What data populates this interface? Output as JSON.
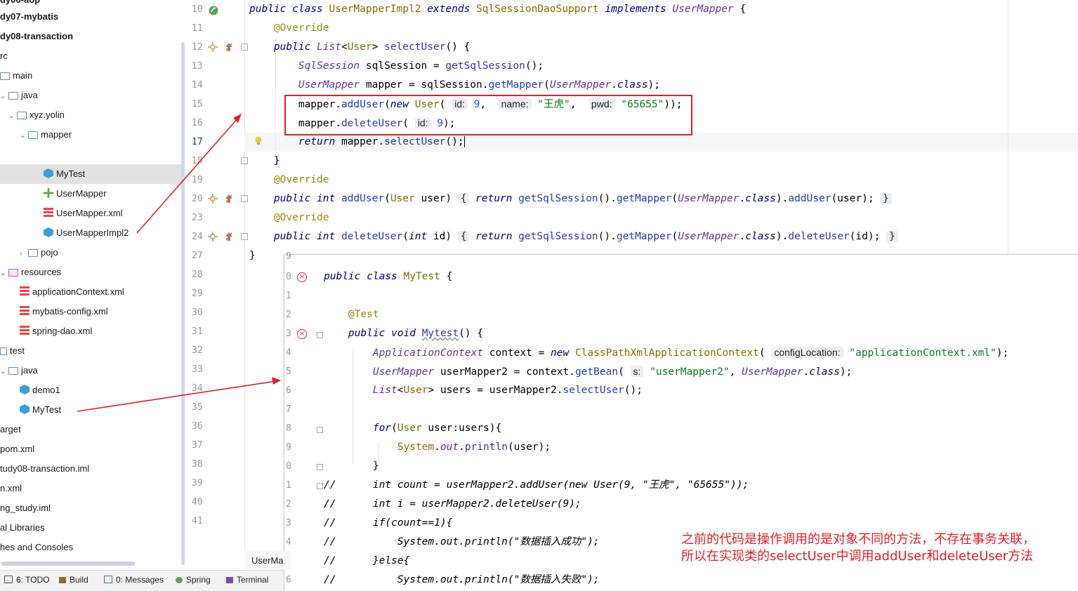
{
  "colors": {
    "accent_red": "#e0202a",
    "selection": "#e1e1e1"
  },
  "project_tree": [
    {
      "label": "dy06-aop",
      "bold": true,
      "icon": "module-folder-icon"
    },
    {
      "label": "dy07-mybatis",
      "bold": true,
      "icon": "module-folder-icon"
    },
    {
      "label": "dy08-transaction",
      "bold": true,
      "icon": "module-folder-icon"
    },
    {
      "label": "rc",
      "icon": "folder-icon"
    },
    {
      "label": "main",
      "icon": "folder-icon"
    },
    {
      "label": "java",
      "icon": "folder-icon"
    },
    {
      "label": "xyz.yolin",
      "icon": "package-icon"
    },
    {
      "label": "mapper",
      "icon": "package-icon"
    },
    {
      "label": "MyTest",
      "icon": "class-icon",
      "selected": true
    },
    {
      "label": "UserMapper",
      "icon": "interface-icon"
    },
    {
      "label": "UserMapper.xml",
      "icon": "xml-file-icon"
    },
    {
      "label": "UserMapperImpl2",
      "icon": "class-icon"
    },
    {
      "label": "pojo",
      "icon": "package-icon"
    },
    {
      "label": "resources",
      "icon": "resources-folder-icon"
    },
    {
      "label": "applicationContext.xml",
      "icon": "xml-file-icon"
    },
    {
      "label": "mybatis-config.xml",
      "icon": "xml-file-icon"
    },
    {
      "label": "spring-dao.xml",
      "icon": "xml-file-icon"
    },
    {
      "label": "test",
      "icon": "folder-icon"
    },
    {
      "label": "java",
      "icon": "folder-icon"
    },
    {
      "label": "demo1",
      "icon": "class-icon"
    },
    {
      "label": "MyTest",
      "icon": "class-icon"
    },
    {
      "label": "arget",
      "icon": "folder-icon"
    },
    {
      "label": "pom.xml",
      "icon": "xml-file-icon"
    },
    {
      "label": "tudy08-transaction.iml",
      "icon": "file-icon"
    },
    {
      "label": "n.xml",
      "icon": "xml-file-icon"
    },
    {
      "label": "ng_study.iml",
      "icon": "file-icon"
    },
    {
      "label": "al Libraries",
      "icon": "library-icon"
    },
    {
      "label": "hes and Consoles",
      "icon": "scratch-icon"
    }
  ],
  "editor": {
    "line_numbers": [
      "10",
      "11",
      "12",
      "13",
      "14",
      "15",
      "16",
      "17",
      "18",
      "19",
      "20",
      "23",
      "24",
      "27",
      "28",
      "29",
      "30",
      "31",
      "32",
      "33",
      "34",
      "35",
      "36",
      "37",
      "38",
      "39",
      "40",
      "41"
    ],
    "current_line": "17",
    "partial_tab": "UserMa",
    "hints": {
      "id": "id:",
      "name": "name:",
      "pwd": "pwd:"
    },
    "strings": {
      "wanghu": "\"王虎\"",
      "pwd_value": "\"65655\""
    },
    "numbers": {
      "nine": "9"
    }
  },
  "overlay": {
    "line_numbers": [
      "9",
      "0",
      "1",
      "2",
      "3",
      "4",
      "5",
      "6",
      "7",
      "8",
      "9",
      "0",
      "1",
      "2",
      "3",
      "4",
      "5",
      "6"
    ],
    "hints": {
      "configLocation": "configLocation:",
      "s": "s:"
    },
    "strings": {
      "app_ctx": "\"applicationContext.xml\"",
      "bean": "\"userMapper2\"",
      "comment_add": "//      int count = userMapper2.addUser(new User(9, \"王虎\", \"65655\"));",
      "comment_del": "//      int i = userMapper2.deleteUser(9);",
      "comment_if": "//      if(count==1){",
      "comment_ok": "//          System.out.println(\"数据插入成功\");",
      "comment_else": "//      }else{",
      "comment_fail": "//          System.out.println(\"数据插入失败\");"
    },
    "note_line1": "之前的代码是操作调用的是对象不同的方法，不存在事务关联，",
    "note_line2": "所以在实现类的selectUser中调用addUser和deleteUser方法"
  },
  "bottom_tabs": [
    {
      "label": "6: TODO",
      "icon": "todo-icon"
    },
    {
      "label": "Build",
      "icon": "build-icon"
    },
    {
      "label": "0: Messages",
      "icon": "messages-icon"
    },
    {
      "label": "Spring",
      "icon": "spring-icon"
    },
    {
      "label": "Terminal",
      "icon": "terminal-icon"
    }
  ]
}
